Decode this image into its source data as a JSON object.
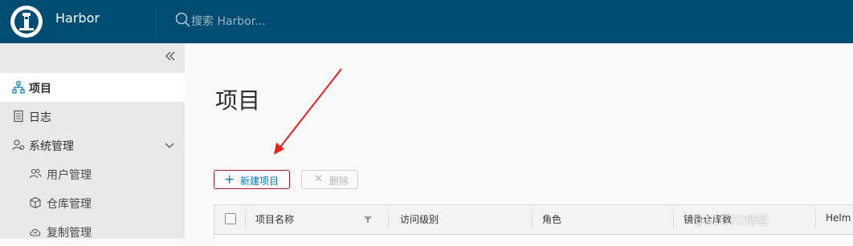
{
  "header": {
    "brand": "Harbor",
    "search_placeholder": "搜索 Harbor..."
  },
  "sidebar": {
    "items": [
      {
        "label": "项目",
        "icon": "project-tree-icon",
        "active": true
      },
      {
        "label": "日志",
        "icon": "log-document-icon"
      },
      {
        "label": "系统管理",
        "icon": "user-settings-icon",
        "expanded": true
      },
      {
        "label": "用户管理",
        "icon": "users-icon",
        "sub": true
      },
      {
        "label": "仓库管理",
        "icon": "registry-box-icon",
        "sub": true
      },
      {
        "label": "复制管理",
        "icon": "replication-cloud-icon",
        "sub": true
      }
    ]
  },
  "main": {
    "title": "项目",
    "new_project_label": "新建项目",
    "delete_label": "删除",
    "columns": [
      "项目名称",
      "访问级别",
      "角色",
      "镜像仓库数",
      "Helm"
    ]
  },
  "watermark": "@51CTO博客",
  "colors": {
    "header_bg": "#014c72",
    "sidebar_bg": "#e9e9e9",
    "accent": "#0079b8",
    "annotation_arrow": "#e8201e"
  }
}
